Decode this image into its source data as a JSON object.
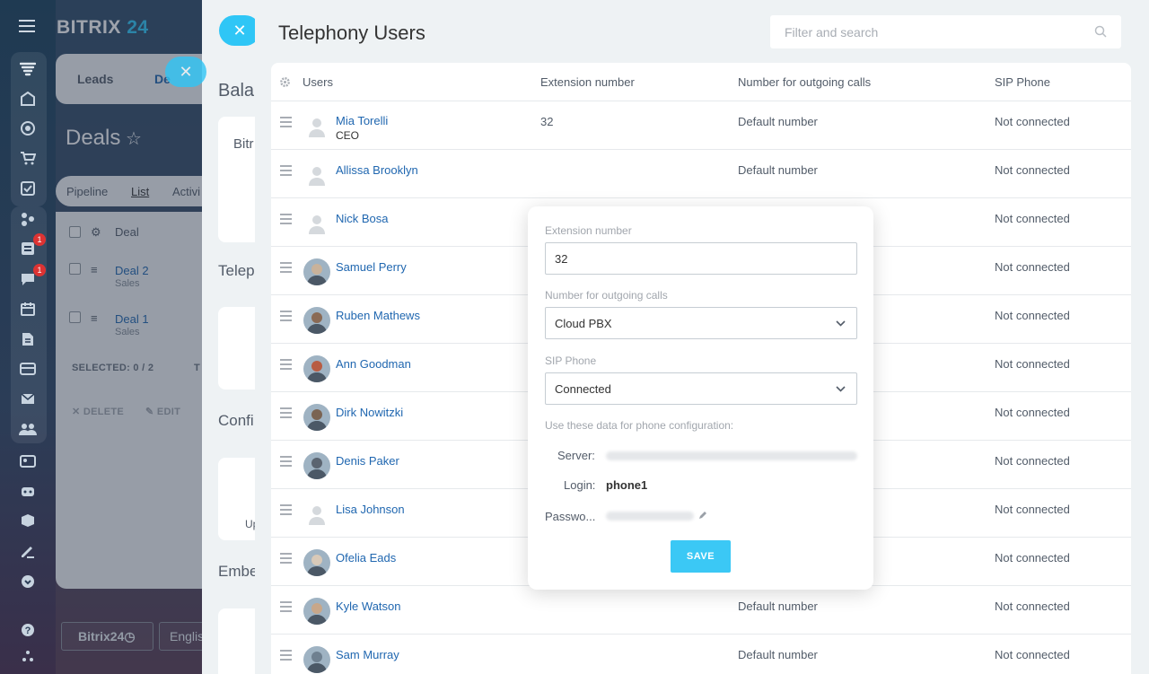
{
  "background": {
    "brand": {
      "name": "BITRIX",
      "num": "24"
    },
    "tabs": [
      "Leads",
      "De"
    ],
    "title": "Deals",
    "views": [
      "Pipeline",
      "List",
      "Activi"
    ],
    "grid_header": "Deal",
    "deals": [
      {
        "name": "Deal 2",
        "stage": "Sales"
      },
      {
        "name": "Deal 1",
        "stage": "Sales"
      }
    ],
    "selected": "SELECTED: 0 / 2",
    "to": "T",
    "delete": "DELETE",
    "edit": "EDIT",
    "footer": {
      "brand_btn": "Bitrix24",
      "lang_btn": "Englis"
    },
    "badges": [
      "1",
      "1"
    ],
    "mid": {
      "bal": "Bala",
      "bitr": "Bitr",
      "telep": "Telep",
      "confi": "Confi",
      "up": "Up",
      "embe": "Embe"
    }
  },
  "slider": {
    "title": "Telephony Users",
    "search_placeholder": "Filter and search",
    "columns": [
      "Users",
      "Extension number",
      "Number for outgoing calls",
      "SIP Phone"
    ],
    "rows": [
      {
        "name": "Mia Torelli",
        "position": "CEO",
        "ext": "32",
        "outgoing": "Default number",
        "sip": "Not connected"
      },
      {
        "name": "Allissa Brooklyn",
        "position": "",
        "ext": "",
        "outgoing": "Default number",
        "sip": "Not connected"
      },
      {
        "name": "Nick Bosa",
        "position": "",
        "ext": "",
        "outgoing": "",
        "sip": "Not connected"
      },
      {
        "name": "Samuel Perry",
        "position": "",
        "ext": "",
        "outgoing": "",
        "sip": "Not connected"
      },
      {
        "name": "Ruben Mathews",
        "position": "",
        "ext": "",
        "outgoing": "",
        "sip": "Not connected"
      },
      {
        "name": "Ann Goodman",
        "position": "",
        "ext": "",
        "outgoing": "",
        "sip": "Not connected"
      },
      {
        "name": "Dirk Nowitzki",
        "position": "",
        "ext": "",
        "outgoing": "",
        "sip": "Not connected"
      },
      {
        "name": "Denis Paker",
        "position": "",
        "ext": "",
        "outgoing": "",
        "sip": "Not connected"
      },
      {
        "name": "Lisa Johnson",
        "position": "",
        "ext": "",
        "outgoing": "",
        "sip": "Not connected"
      },
      {
        "name": "Ofelia Eads",
        "position": "",
        "ext": "",
        "outgoing": "",
        "sip": "Not connected"
      },
      {
        "name": "Kyle Watson",
        "position": "",
        "ext": "",
        "outgoing": "Default number",
        "sip": "Not connected"
      },
      {
        "name": "Sam Murray",
        "position": "",
        "ext": "",
        "outgoing": "Default number",
        "sip": "Not connected"
      }
    ]
  },
  "popup": {
    "ext_label": "Extension number",
    "ext_value": "32",
    "outgoing_label": "Number for outgoing calls",
    "outgoing_value": "Cloud PBX",
    "sip_label": "SIP Phone",
    "sip_value": "Connected",
    "hint": "Use these data for phone configuration:",
    "server_label": "Server:",
    "login_label": "Login:",
    "login_value": "phone1",
    "password_label": "Passwo...",
    "save_label": "SAVE"
  },
  "colors": {
    "accent": "#2fc6f6",
    "link": "#2067b0",
    "save": "#3bc8f5",
    "badge": "#dd3333"
  }
}
